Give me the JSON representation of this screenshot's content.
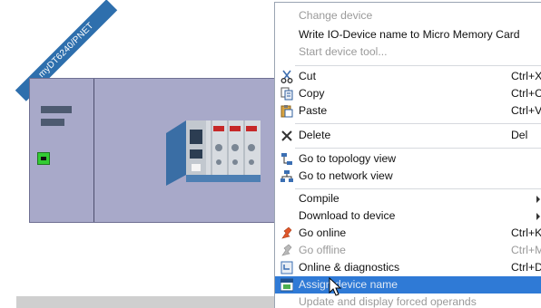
{
  "device": {
    "name": "myDT6240/PNET"
  },
  "context_menu": {
    "items": [
      {
        "label": "Change device",
        "shortcut": "",
        "icon": "",
        "state": "disabled"
      },
      {
        "label": "Write IO-Device name to Micro Memory Card",
        "shortcut": "",
        "icon": "",
        "state": "normal"
      },
      {
        "label": "Start device tool...",
        "shortcut": "",
        "icon": "",
        "state": "disabled"
      },
      {
        "label": "Cut",
        "shortcut": "Ctrl+X",
        "icon": "scissors-icon",
        "state": "normal"
      },
      {
        "label": "Copy",
        "shortcut": "Ctrl+C",
        "icon": "copy-icon",
        "state": "normal"
      },
      {
        "label": "Paste",
        "shortcut": "Ctrl+V",
        "icon": "paste-icon",
        "state": "normal"
      },
      {
        "label": "Delete",
        "shortcut": "Del",
        "icon": "delete-x-icon",
        "state": "normal"
      },
      {
        "label": "Go to topology view",
        "shortcut": "",
        "icon": "topology-view-icon",
        "state": "normal"
      },
      {
        "label": "Go to network view",
        "shortcut": "",
        "icon": "network-view-icon",
        "state": "normal"
      },
      {
        "label": "Compile",
        "shortcut": "",
        "icon": "",
        "state": "normal",
        "submenu": true
      },
      {
        "label": "Download to device",
        "shortcut": "",
        "icon": "",
        "state": "normal",
        "submenu": true
      },
      {
        "label": "Go online",
        "shortcut": "Ctrl+K",
        "icon": "go-online-icon",
        "state": "normal"
      },
      {
        "label": "Go offline",
        "shortcut": "Ctrl+M",
        "icon": "go-offline-icon",
        "state": "disabled"
      },
      {
        "label": "Online & diagnostics",
        "shortcut": "Ctrl+D",
        "icon": "diagnostics-icon",
        "state": "normal"
      },
      {
        "label": "Assign device name",
        "shortcut": "",
        "icon": "assign-name-icon",
        "state": "selected"
      },
      {
        "label": "Update and display forced operands",
        "shortcut": "",
        "icon": "",
        "state": "disabled"
      }
    ]
  },
  "colors": {
    "device_background": "#a8a9c9",
    "device_tag": "#2e6fad",
    "port_active": "#33cc33",
    "menu_selected": "#2f7ad6",
    "menu_disabled_text": "#9a9a9a"
  }
}
